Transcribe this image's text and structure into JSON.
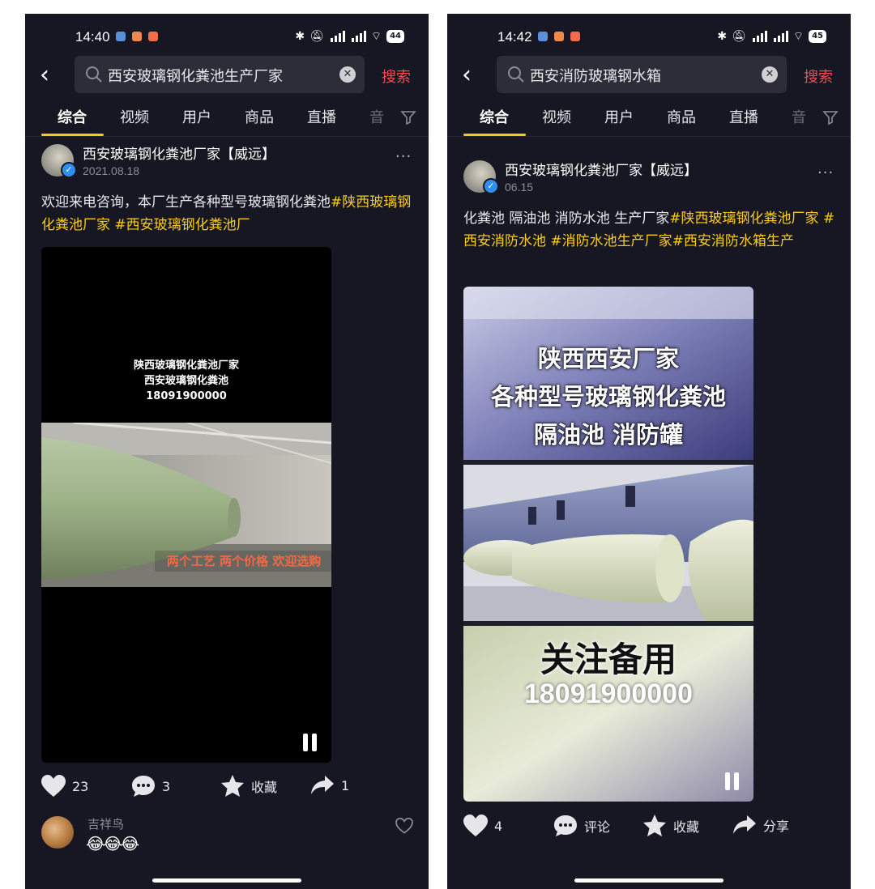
{
  "left": {
    "status": {
      "time": "14:40",
      "battery": "44"
    },
    "search": {
      "query": "西安玻璃钢化粪池生产厂家",
      "button": "搜索"
    },
    "tabs": [
      "综合",
      "视频",
      "用户",
      "商品",
      "直播",
      "音"
    ],
    "post": {
      "author": "西安玻璃钢化粪池厂家【威远】",
      "date": "2021.08.18",
      "text": "欢迎来电咨询，本厂生产各种型号玻璃钢化粪池",
      "tags": "#陕西玻璃钢化粪池厂家 #西安玻璃钢化粪池厂",
      "video_lines": [
        "陕西玻璃钢化粪池厂家",
        "西安玻璃钢化粪池",
        "18091900000"
      ],
      "video_caption": "两个工艺 两个价格 欢迎选购",
      "likes": "23",
      "comments": "3",
      "favorite_label": "收藏",
      "shares": "1"
    },
    "comment": {
      "user": "吉祥鸟",
      "emojis": "😂😂😂"
    }
  },
  "right": {
    "status": {
      "time": "14:42",
      "battery": "45"
    },
    "search": {
      "query": "西安消防玻璃钢水箱",
      "button": "搜索"
    },
    "tabs": [
      "综合",
      "视频",
      "用户",
      "商品",
      "直播",
      "音"
    ],
    "post": {
      "author": "西安玻璃钢化粪池厂家【威远】",
      "date": "06.15",
      "text": "化粪池 隔油池 消防水池 生产厂家",
      "tags": "#陕西玻璃钢化粪池厂家 #西安消防水池 #消防水池生产厂家#西安消防水箱生产",
      "panel_lines": [
        "陕西西安厂家",
        "各种型号玻璃钢化粪池",
        "隔油池 消防罐"
      ],
      "follow_title": "关注备用",
      "follow_phone": "18091900000",
      "likes": "4",
      "comment_label": "评论",
      "favorite_label": "收藏",
      "share_label": "分享"
    }
  },
  "colors": {
    "background": "#161722",
    "accent": "#facc15",
    "search_red": "#f24c5a",
    "verify": "#2f8ef4"
  }
}
